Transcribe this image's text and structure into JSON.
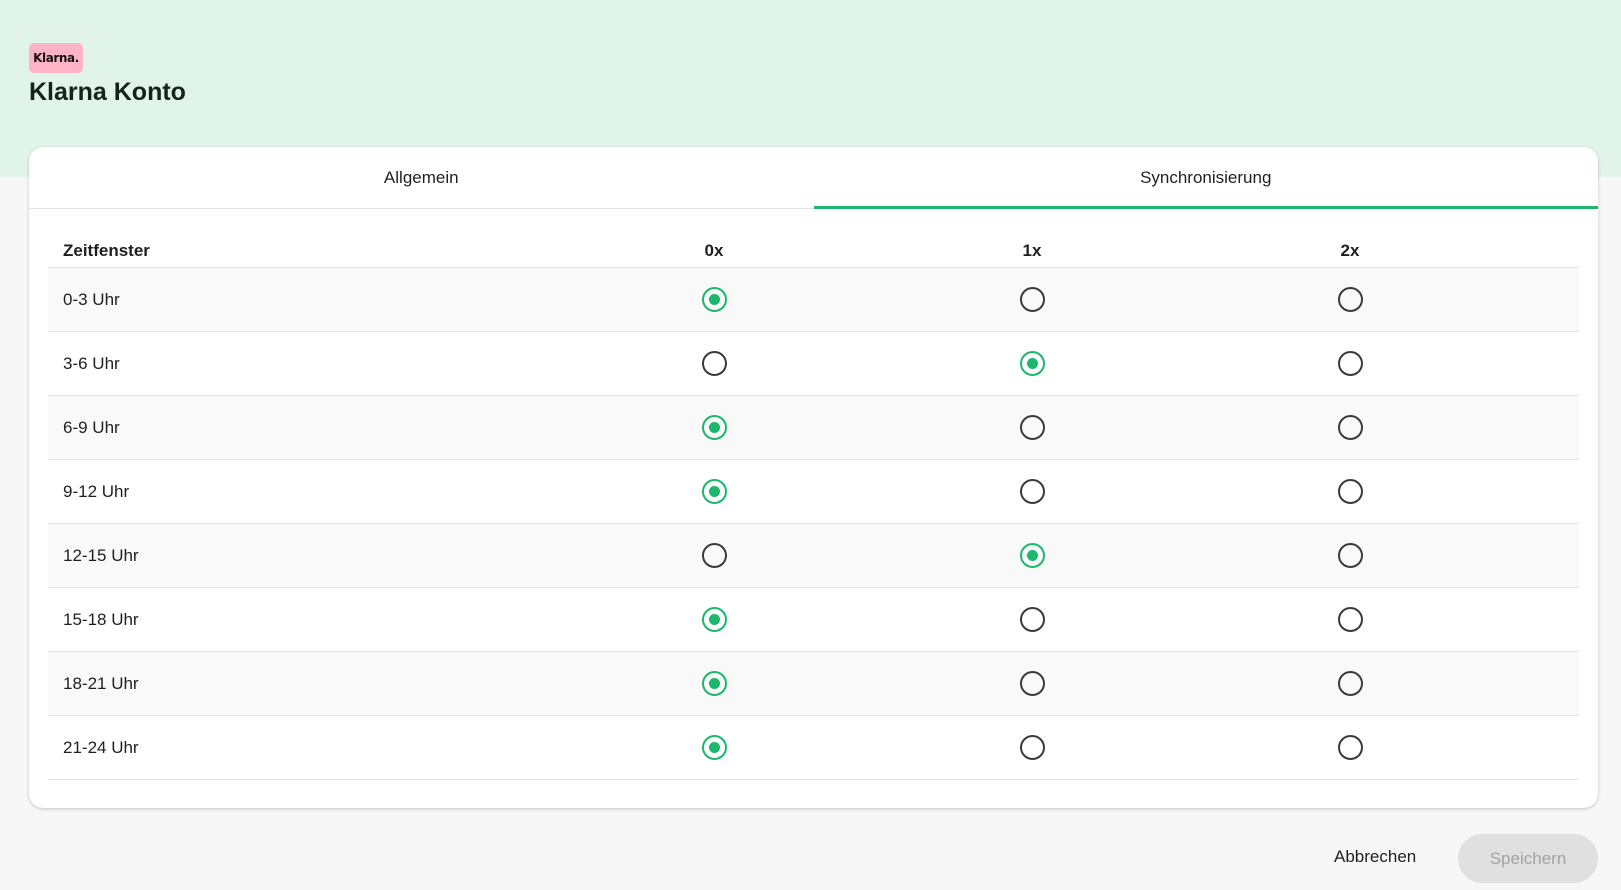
{
  "header": {
    "brand_badge": "Klarna.",
    "title": "Klarna Konto"
  },
  "tabs": [
    {
      "label": "Allgemein",
      "active": false
    },
    {
      "label": "Synchronisierung",
      "active": true
    }
  ],
  "schedule": {
    "column_header": "Zeitfenster",
    "options": [
      "0x",
      "1x",
      "2x"
    ],
    "rows": [
      {
        "label": "0-3 Uhr",
        "selected": "0x"
      },
      {
        "label": "3-6 Uhr",
        "selected": "1x"
      },
      {
        "label": "6-9 Uhr",
        "selected": "0x"
      },
      {
        "label": "9-12 Uhr",
        "selected": "0x"
      },
      {
        "label": "12-15 Uhr",
        "selected": "1x"
      },
      {
        "label": "15-18 Uhr",
        "selected": "0x"
      },
      {
        "label": "18-21 Uhr",
        "selected": "0x"
      },
      {
        "label": "21-24 Uhr",
        "selected": "0x"
      }
    ]
  },
  "actions": {
    "cancel_label": "Abbrechen",
    "save_label": "Speichern",
    "save_disabled": true
  },
  "colors": {
    "header_background": "#e1f4ea",
    "accent_green": "#1fb56c",
    "brand_pink": "#ffb3c7"
  }
}
